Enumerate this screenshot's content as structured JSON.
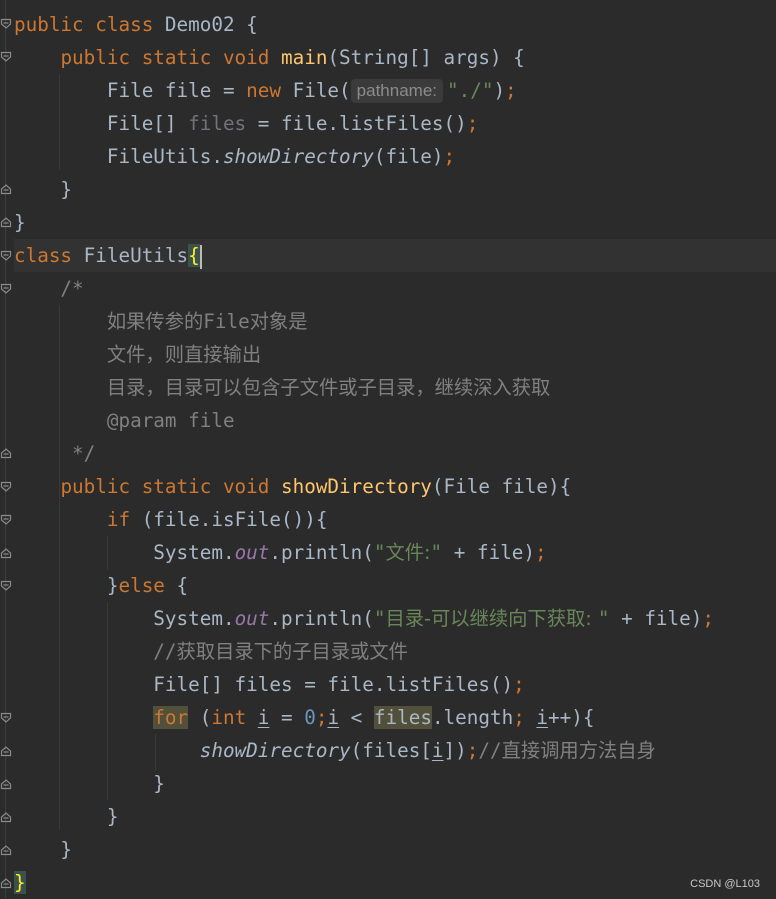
{
  "lines": [
    {
      "segs": [
        [
          "kw",
          "public class "
        ],
        [
          "",
          "Demo02 {"
        ]
      ]
    },
    {
      "segs": [
        [
          "",
          "    "
        ],
        [
          "kw",
          "public static void "
        ],
        [
          "fn",
          "main"
        ],
        [
          "",
          "(String[] args) {"
        ]
      ]
    },
    {
      "segs": [
        [
          "",
          "        File file = "
        ],
        [
          "kw",
          "new "
        ],
        [
          "",
          "File("
        ],
        [
          "hint",
          "pathname:"
        ],
        [
          "str",
          "\"./\""
        ],
        [
          "",
          ")"
        ],
        [
          "kw",
          ";"
        ]
      ]
    },
    {
      "segs": [
        [
          "",
          "        File[] "
        ],
        [
          "unused",
          "files"
        ],
        [
          "",
          " = file.listFiles()"
        ],
        [
          "kw",
          ";"
        ]
      ]
    },
    {
      "segs": [
        [
          "",
          "        FileUtils."
        ],
        [
          "it",
          "showDirectory"
        ],
        [
          "",
          "(file)"
        ],
        [
          "kw",
          ";"
        ]
      ]
    },
    {
      "segs": [
        [
          "",
          "    }"
        ]
      ]
    },
    {
      "segs": [
        [
          "",
          "}"
        ]
      ]
    },
    {
      "segs": [
        [
          "kw",
          "class "
        ],
        [
          "",
          "FileUtils"
        ],
        [
          "brace",
          "{"
        ],
        [
          "caret",
          ""
        ]
      ]
    },
    {
      "segs": [
        [
          "comment",
          "    /*"
        ]
      ]
    },
    {
      "segs": [
        [
          "comment",
          "        "
        ],
        [
          "comment cjk",
          "如果传参的"
        ],
        [
          "comment",
          "File"
        ],
        [
          "comment cjk",
          "对象是"
        ]
      ]
    },
    {
      "segs": [
        [
          "comment",
          "        "
        ],
        [
          "comment cjk",
          "文件，则直接输出"
        ]
      ]
    },
    {
      "segs": [
        [
          "comment",
          "        "
        ],
        [
          "comment cjk",
          "目录，目录可以包含子文件或子目录，继续深入获取"
        ]
      ]
    },
    {
      "segs": [
        [
          "comment",
          "        @param file"
        ]
      ]
    },
    {
      "segs": [
        [
          "comment",
          "     */"
        ]
      ]
    },
    {
      "segs": [
        [
          "",
          "    "
        ],
        [
          "kw",
          "public static void "
        ],
        [
          "fn",
          "showDirectory"
        ],
        [
          "",
          "(File file){"
        ]
      ]
    },
    {
      "segs": [
        [
          "",
          "        "
        ],
        [
          "kw",
          "if "
        ],
        [
          "",
          "(file.isFile()){"
        ]
      ]
    },
    {
      "segs": [
        [
          "",
          "            System."
        ],
        [
          "field",
          "out"
        ],
        [
          "",
          ".println("
        ],
        [
          "str",
          "\""
        ],
        [
          "str cjk",
          "文件:"
        ],
        [
          "str",
          "\""
        ],
        [
          "",
          " + file)"
        ],
        [
          "kw",
          ";"
        ]
      ]
    },
    {
      "segs": [
        [
          "",
          "        }"
        ],
        [
          "kw",
          "else "
        ],
        [
          "",
          "{"
        ]
      ]
    },
    {
      "segs": [
        [
          "",
          "            System."
        ],
        [
          "field",
          "out"
        ],
        [
          "",
          ".println("
        ],
        [
          "str",
          "\""
        ],
        [
          "str cjk",
          "目录-可以继续向下获取: "
        ],
        [
          "str",
          "\""
        ],
        [
          "",
          " + file)"
        ],
        [
          "kw",
          ";"
        ]
      ]
    },
    {
      "segs": [
        [
          "comment",
          "            //"
        ],
        [
          "comment cjk",
          "获取目录下的子目录或文件"
        ]
      ]
    },
    {
      "segs": [
        [
          "",
          "            File[] files = file.listFiles()"
        ],
        [
          "kw",
          ";"
        ]
      ]
    },
    {
      "segs": [
        [
          "",
          "            "
        ],
        [
          "kw hl",
          "for"
        ],
        [
          "",
          " ("
        ],
        [
          "kw",
          "int "
        ],
        [
          "ul",
          "i"
        ],
        [
          "",
          " = "
        ],
        [
          "num",
          "0"
        ],
        [
          "kw",
          ";"
        ],
        [
          "ul",
          "i"
        ],
        [
          "",
          " < "
        ],
        [
          "hl",
          "files"
        ],
        [
          "",
          ".length"
        ],
        [
          "kw",
          "; "
        ],
        [
          "ul",
          "i"
        ],
        [
          "",
          "++){"
        ]
      ]
    },
    {
      "segs": [
        [
          "",
          "                "
        ],
        [
          "it",
          "showDirectory"
        ],
        [
          "",
          "(files["
        ],
        [
          "ul",
          "i"
        ],
        [
          "",
          "])"
        ],
        [
          "kw",
          ";"
        ],
        [
          "comment",
          "//"
        ],
        [
          "comment cjk",
          "直接调用方法自身"
        ]
      ]
    },
    {
      "segs": [
        [
          "",
          "            }"
        ]
      ]
    },
    {
      "segs": [
        [
          "",
          "        }"
        ]
      ]
    },
    {
      "segs": [
        [
          "",
          "    }"
        ]
      ]
    },
    {
      "segs": [
        [
          "brace",
          "}"
        ]
      ]
    }
  ],
  "watermark": "CSDN @L103",
  "accent": "#cc7832"
}
